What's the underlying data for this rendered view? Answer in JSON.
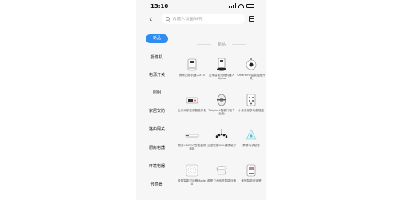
{
  "status_bar": {
    "time": "13:10"
  },
  "search": {
    "placeholder": "请输入设备名称"
  },
  "sidebar": {
    "items": [
      {
        "label": "新品",
        "active": true
      },
      {
        "label": "摄像机"
      },
      {
        "label": "电源开关"
      },
      {
        "label": "照明"
      },
      {
        "label": "家居安防"
      },
      {
        "label": "路由网关"
      },
      {
        "label": "厨房电器"
      },
      {
        "label": "环境电器"
      },
      {
        "label": "传感器"
      }
    ]
  },
  "section": {
    "title": "新品"
  },
  "products": [
    {
      "name": "睿米扫拖机器人X10",
      "icon": "robot-vacuum-icon"
    },
    {
      "name": "云米智能扫拖机器人Alpha",
      "icon": "robot-mop-icon"
    },
    {
      "name": "Smartline智能插座开关",
      "icon": "smart-plug-icon"
    },
    {
      "name": "云米米家空调智能伴侣",
      "icon": "ac-companion-icon"
    },
    {
      "name": "Tuliplock智能门锁专业版",
      "icon": "door-lock-icon"
    },
    {
      "name": "小米米家多功能插座",
      "icon": "power-strip-icon"
    },
    {
      "name": "易开LINFOO智能窗帘电机",
      "icon": "curtain-motor-icon"
    },
    {
      "name": "三诺智能Fillit健康吊灯",
      "icon": "pendant-lamp-icon"
    },
    {
      "name": "梦想电子蚊香",
      "icon": "mosquito-repeller-icon"
    },
    {
      "name": "欧普智能过滤器Model A",
      "icon": "air-filter-icon"
    },
    {
      "name": "希爱卫大网洗智能马桶",
      "icon": "smart-toilet-icon"
    },
    {
      "name": "美的智能电饭煲",
      "icon": "rice-cooker-icon"
    }
  ]
}
